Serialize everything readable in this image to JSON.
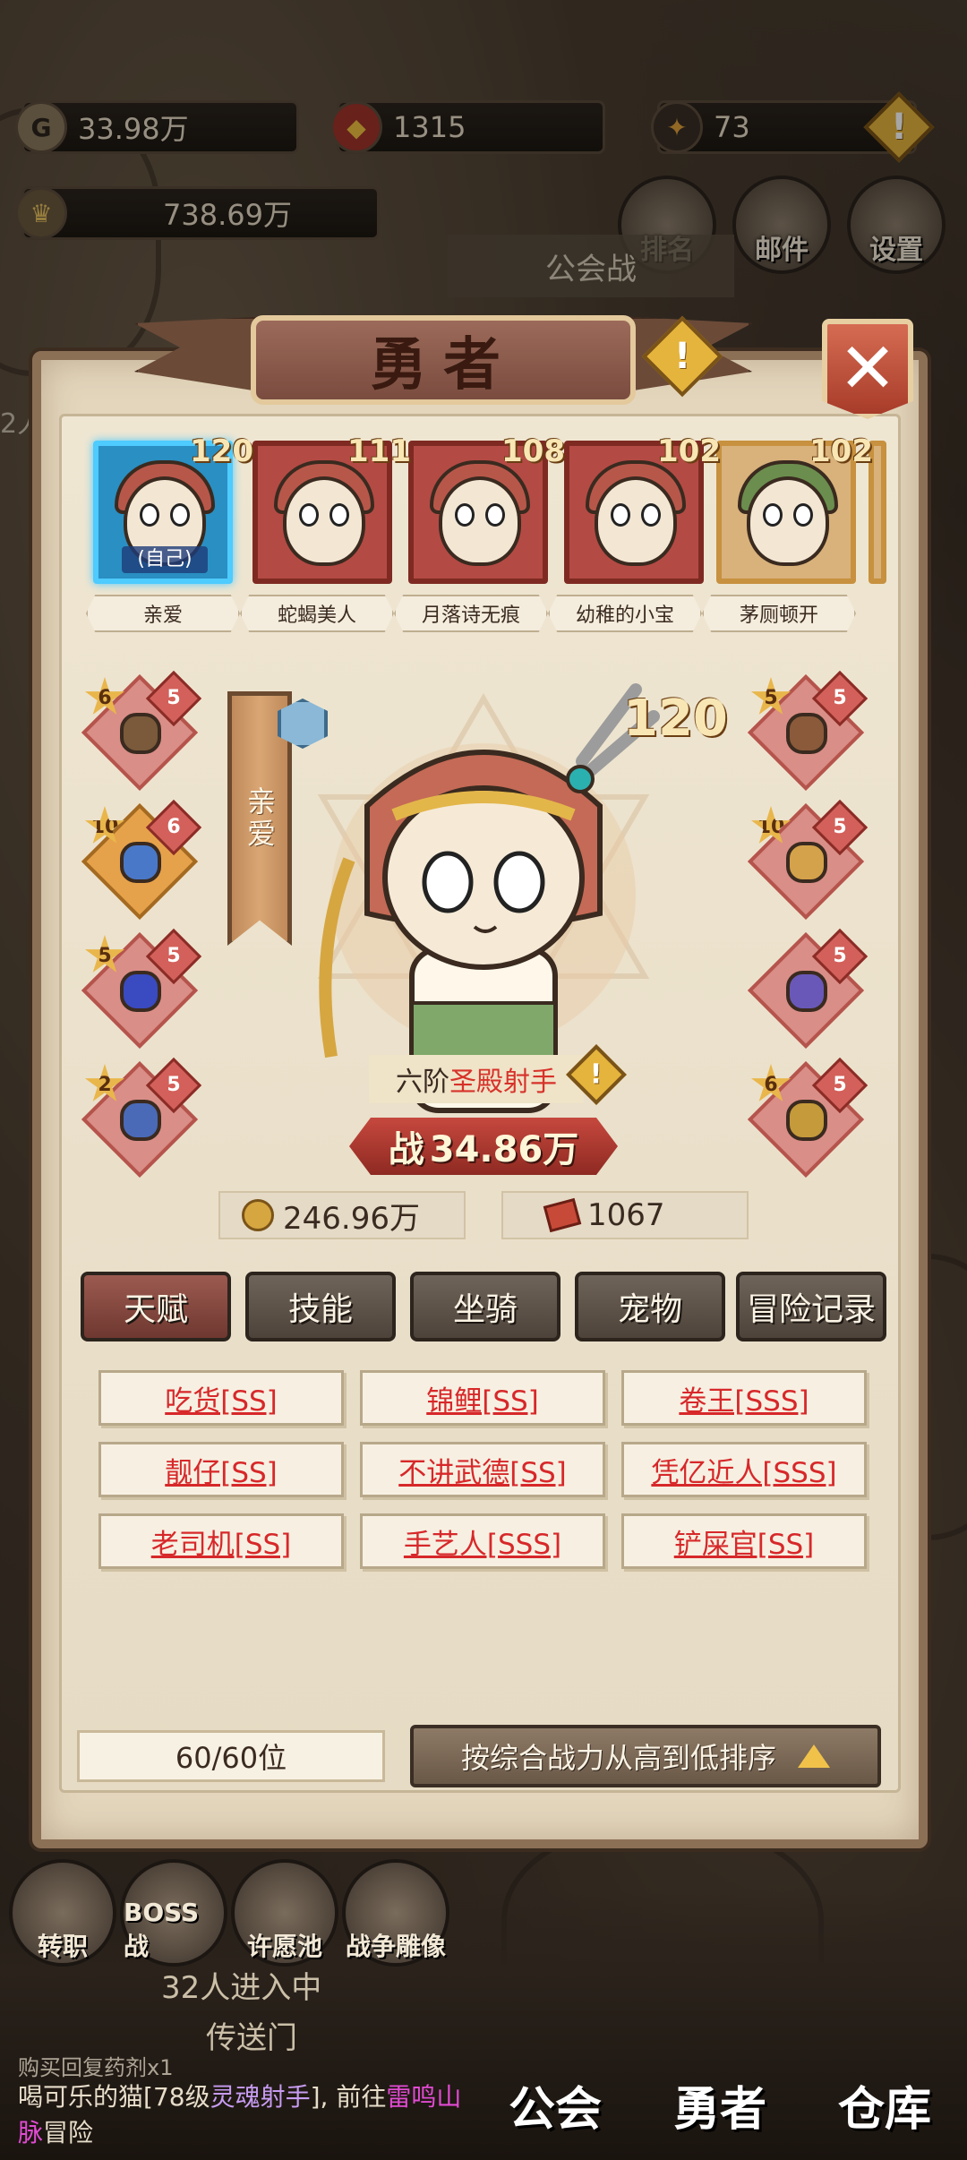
{
  "resources": {
    "gold": "33.98万",
    "gems": "1315",
    "bag": "73",
    "total_power": "738.69万"
  },
  "top_buttons": [
    "排名",
    "邮件",
    "设置"
  ],
  "background_labels": {
    "guild_war": "公会战",
    "side_left": "2人",
    "teleport_count": "32人进入中",
    "teleport": "传送门"
  },
  "modal": {
    "title": "勇者",
    "close_label": "✕",
    "heroes": [
      {
        "name": "亲爱",
        "level": "120",
        "selected": true,
        "self_tag": "(自己)"
      },
      {
        "name": "蛇蝎美人",
        "level": "111"
      },
      {
        "name": "月落诗无痕",
        "level": "108"
      },
      {
        "name": "幼稚的小宝",
        "level": "102"
      },
      {
        "name": "茅厕顿开",
        "level": "102"
      }
    ],
    "detail": {
      "name": "亲爱",
      "level": "120",
      "rank_prefix": "六阶",
      "class_name": "圣殿射手",
      "power_prefix": "战",
      "power": "34.86万",
      "gold": "246.96万",
      "tickets": "1067"
    },
    "equipment_left": [
      {
        "star": "6",
        "badge": "5",
        "icon": "crossbow-icon",
        "color": "#7a5a3a"
      },
      {
        "star": "10",
        "badge": "6",
        "icon": "armor-icon",
        "color": "#4a78c8"
      },
      {
        "star": "5",
        "badge": "5",
        "icon": "cloak-icon",
        "color": "#3a4ac0"
      },
      {
        "star": "2",
        "badge": "5",
        "icon": "boots-icon",
        "color": "#4a6ab8"
      }
    ],
    "equipment_right": [
      {
        "star": "5",
        "badge": "5",
        "icon": "necklace-icon",
        "color": "#8a5a3a"
      },
      {
        "star": "10",
        "badge": "5",
        "icon": "bracelet-icon",
        "color": "#d4a24a"
      },
      {
        "star": "",
        "badge": "5",
        "icon": "wings-icon",
        "color": "#6a58b8"
      },
      {
        "star": "6",
        "badge": "5",
        "icon": "staff-icon",
        "color": "#c49a3a"
      }
    ],
    "tabs": [
      "天赋",
      "技能",
      "坐骑",
      "宠物",
      "冒险记录"
    ],
    "talents": [
      "吃货[SS]",
      "锦鲤[SS]",
      "卷王[SSS]",
      "靓仔[SS]",
      "不讲武德[SS]",
      "凭亿近人[SSS]",
      "老司机[SS]",
      "手艺人[SSS]",
      "铲屎官[SS]"
    ],
    "count": "60/60位",
    "sort_label": "按综合战力从高到低排序"
  },
  "bottom_round_buttons": [
    "转职",
    "BOSS战",
    "许愿池",
    "战争雕像"
  ],
  "chat": {
    "line1": "购买回复药剂x1",
    "player": "喝可乐的猫",
    "mid": "[78级",
    "job": "灵魂射手",
    "mid2": "], 前往",
    "place": "雷鸣山脉",
    "tail": "冒险"
  },
  "bottom_tabs": [
    "公会",
    "勇者",
    "仓库"
  ],
  "colors": {
    "accent_red": "#d7282a",
    "selected_border": "#4ecbff"
  }
}
